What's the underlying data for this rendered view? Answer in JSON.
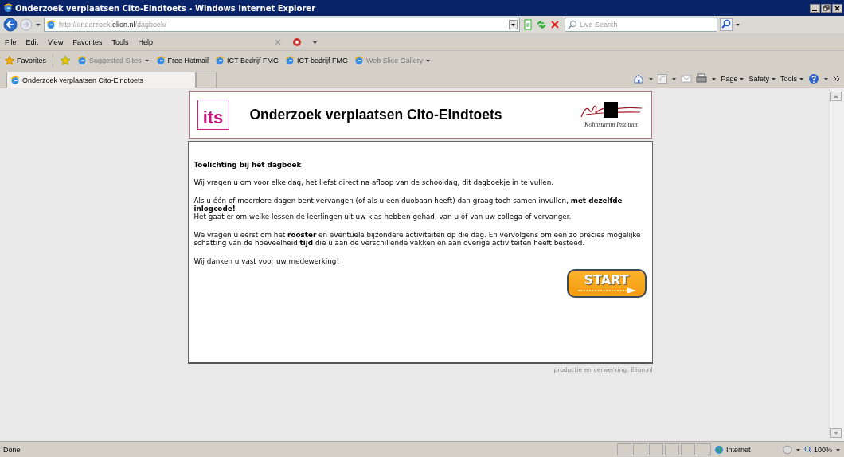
{
  "window": {
    "title": "Onderzoek verplaatsen Cito-Eindtoets - Windows Internet Explorer"
  },
  "address_bar": {
    "url": "http://onderzoek.**elion.nl**/dagboek/"
  },
  "search": {
    "placeholder": "Live Search"
  },
  "menu": [
    "File",
    "Edit",
    "View",
    "Favorites",
    "Tools",
    "Help"
  ],
  "favorites_bar": [
    {
      "label": "Favorites",
      "kind": "star",
      "disabled": false
    },
    {
      "label": "Suggested Sites",
      "kind": "dropdown",
      "disabled": true
    },
    {
      "label": "Free Hotmail",
      "kind": "link",
      "disabled": false
    },
    {
      "label": "ICT Bedrijf FMG",
      "kind": "link",
      "disabled": false
    },
    {
      "label": "ICT-bedrijf FMG",
      "kind": "link",
      "disabled": false
    },
    {
      "label": "Web Slice Gallery",
      "kind": "dropdown",
      "disabled": true
    }
  ],
  "tabs": [
    {
      "label": "Onderzoek verplaatsen Cito-Eindtoets",
      "selected": true
    }
  ],
  "command_bar": [
    "Page",
    "Safety",
    "Tools"
  ],
  "page": {
    "logo": "its",
    "title": "Onderzoek verplaatsen Cito-Eindtoets",
    "signature_caption": "Kohnstamm Instituut",
    "heading": "Toelichting bij het dagboek",
    "paragraphs": [
      {
        "lines": [
          "Wij vragen u om voor elke dag, het liefst direct na afloop van de schooldag, dit dagboekje in te vullen."
        ]
      },
      {
        "lines": [
          "Als u één of meerdere dagen bent vervangen (of als u een duobaan heeft) dan graag toch samen invullen, **met dezelfde inlogcode!**",
          "Het gaat er om welke lessen de leerlingen uit uw klas hebben gehad, van u óf van uw collega of vervanger."
        ]
      },
      {
        "lines": [
          "We vragen u eerst om het **rooster** en eventuele bijzondere activiteiten op die dag. En vervolgens om een zo precies mogelijke schatting van de hoeveelheid **tijd** die u aan de verschillende vakken en aan overige activiteiten heeft besteed."
        ]
      },
      {
        "lines": [
          "Wij danken u vast voor uw medewerking!"
        ]
      }
    ],
    "start_button": "START",
    "footer": "productie en verwerking: Elion.nl"
  },
  "status_bar": {
    "text": "Done",
    "zone": "Internet",
    "zoom": "100%"
  }
}
